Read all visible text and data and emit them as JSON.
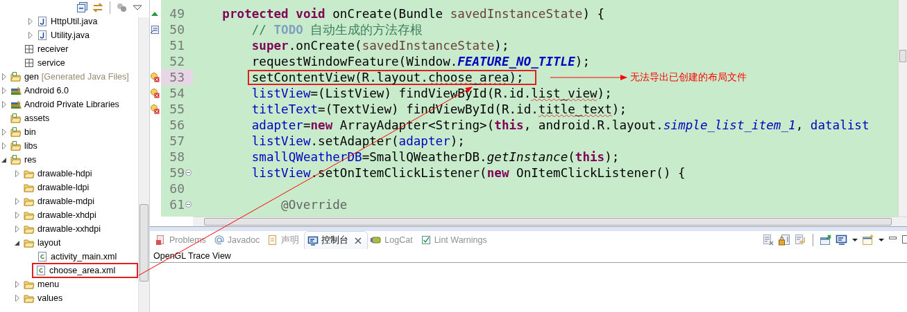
{
  "explorer": {
    "toolbar": [
      {
        "kind": "collapse"
      },
      {
        "kind": "link"
      },
      {
        "kind": "separator"
      },
      {
        "kind": "filter"
      },
      {
        "kind": "menu"
      }
    ],
    "items": [
      {
        "children": [
          {
            "children": [
              {
                "label": "HttpUtil.java",
                "kind": "java",
                "expanded": false
              },
              {
                "label": "Utility.java",
                "kind": "java",
                "expanded": false
              }
            ]
          },
          {
            "label": "receiver",
            "kind": "package"
          },
          {
            "label": "service",
            "kind": "package"
          }
        ]
      },
      {
        "label": "gen",
        "decoration": "[Generated Java Files]",
        "kind": "source-folder",
        "expanded": false
      },
      {
        "label": "Android 6.0",
        "kind": "library",
        "expanded": false
      },
      {
        "label": "Android Private Libraries",
        "kind": "library",
        "expanded": false
      },
      {
        "label": "assets",
        "kind": "source-folder"
      },
      {
        "label": "bin",
        "kind": "source-folder",
        "expanded": false
      },
      {
        "label": "libs",
        "kind": "source-folder",
        "expanded": false
      },
      {
        "label": "res",
        "kind": "source-folder",
        "expanded": true,
        "children": [
          {
            "label": "drawable-hdpi",
            "kind": "folder",
            "expanded": false
          },
          {
            "label": "drawable-ldpi",
            "kind": "folder"
          },
          {
            "label": "drawable-mdpi",
            "kind": "folder",
            "expanded": false
          },
          {
            "label": "drawable-xhdpi",
            "kind": "folder",
            "expanded": false
          },
          {
            "label": "drawable-xxhdpi",
            "kind": "folder",
            "expanded": false
          },
          {
            "label": "layout",
            "kind": "folder",
            "expanded": true,
            "children": [
              {
                "label": "activity_main.xml",
                "kind": "xml"
              },
              {
                "label": "choose_area.xml",
                "kind": "xml",
                "highlighted": true
              }
            ]
          },
          {
            "label": "menu",
            "kind": "folder",
            "expanded": false
          },
          {
            "label": "values",
            "kind": "folder",
            "expanded": false
          }
        ]
      }
    ]
  },
  "editor": {
    "lines": [
      {
        "number": "49",
        "marker": {
          "kind": "override"
        },
        "tokens": [
          {
            "kind": "keyword",
            "text": "protected"
          },
          {
            "kind": "keyword",
            "text": " void"
          },
          {
            "kind": "plain",
            "text": " onCreate(Bundle "
          },
          {
            "kind": "param",
            "text": "savedInstanceState"
          },
          {
            "kind": "plain",
            "text": ") {"
          }
        ],
        "children": [
          {
            "number": "50",
            "marker": {
              "kind": "task"
            },
            "tokens": [
              {
                "kind": "comment",
                "text": "// "
              },
              {
                "kind": "todo",
                "text": "TODO"
              },
              {
                "kind": "comment",
                "text": " 自动生成的方法存根"
              }
            ]
          },
          {
            "number": "51",
            "tokens": [
              {
                "kind": "keyword",
                "text": "super"
              },
              {
                "kind": "plain",
                "text": ".onCreate("
              },
              {
                "kind": "param",
                "text": "savedInstanceState"
              },
              {
                "kind": "plain",
                "text": ");"
              }
            ]
          },
          {
            "number": "52",
            "tokens": [
              {
                "kind": "plain",
                "text": "requestWindowFeature(Window."
              },
              {
                "kind": "constant",
                "text": "FEATURE_NO_TITLE"
              },
              {
                "kind": "plain",
                "text": ");"
              }
            ]
          },
          {
            "number": "53",
            "marker": {
              "kind": "error"
            },
            "current": true,
            "highlighted": true,
            "tokens": [
              {
                "kind": "plain",
                "text": "setContentView(R.layout."
              },
              {
                "kind": "error",
                "text": "choose_area"
              },
              {
                "kind": "plain",
                "text": ");"
              }
            ]
          },
          {
            "number": "54",
            "marker": {
              "kind": "error"
            },
            "tokens": [
              {
                "kind": "field",
                "text": "listView"
              },
              {
                "kind": "plain",
                "text": "=(ListView) findViewById(R.id."
              },
              {
                "kind": "error",
                "text": "list_view"
              },
              {
                "kind": "plain",
                "text": ");"
              }
            ]
          },
          {
            "number": "55",
            "marker": {
              "kind": "error"
            },
            "tokens": [
              {
                "kind": "field",
                "text": "titleText"
              },
              {
                "kind": "plain",
                "text": "=(TextView) findViewById(R.id."
              },
              {
                "kind": "error",
                "text": "title_text"
              },
              {
                "kind": "plain",
                "text": ");"
              }
            ]
          },
          {
            "number": "56",
            "tokens": [
              {
                "kind": "field",
                "text": "adapter"
              },
              {
                "kind": "plain",
                "text": "="
              },
              {
                "kind": "keyword",
                "text": "new"
              },
              {
                "kind": "plain",
                "text": " ArrayAdapter<String>("
              },
              {
                "kind": "keyword",
                "text": "this"
              },
              {
                "kind": "plain",
                "text": ", android.R.layout."
              },
              {
                "kind": "static",
                "text": "simple_list_item_1"
              },
              {
                "kind": "plain",
                "text": ", "
              },
              {
                "kind": "field",
                "text": "datalist"
              }
            ]
          },
          {
            "number": "57",
            "tokens": [
              {
                "kind": "field",
                "text": "listView"
              },
              {
                "kind": "plain",
                "text": ".setAdapter("
              },
              {
                "kind": "field",
                "text": "adapter"
              },
              {
                "kind": "plain",
                "text": ");"
              }
            ]
          },
          {
            "number": "58",
            "tokens": [
              {
                "kind": "field",
                "text": "smallQWeatherDB"
              },
              {
                "kind": "plain",
                "text": "=SmallQWeatherDB."
              },
              {
                "kind": "method",
                "text": "getInstance"
              },
              {
                "kind": "plain",
                "text": "("
              },
              {
                "kind": "keyword",
                "text": "this"
              },
              {
                "kind": "plain",
                "text": ");"
              }
            ]
          },
          {
            "number": "59",
            "collapsed": false,
            "tokens": [
              {
                "kind": "field",
                "text": "listView"
              },
              {
                "kind": "plain",
                "text": ".setOnItemClickListener("
              },
              {
                "kind": "keyword",
                "text": "new"
              },
              {
                "kind": "plain",
                "text": " OnItemClickListener() {"
              }
            ],
            "children": [
              {
                "number": "60"
              },
              {
                "number": "61",
                "collapsed": false,
                "tokens": [
                  {
                    "kind": "annotation",
                    "text": "@Override"
                  }
                ]
              }
            ]
          }
        ]
      }
    ]
  },
  "panel": {
    "tabs": [
      {
        "label": "Problems",
        "kind": "problems",
        "selected": false
      },
      {
        "label": "Javadoc",
        "kind": "javadoc",
        "selected": false
      },
      {
        "label": "声明",
        "kind": "declaration",
        "selected": false
      },
      {
        "label": "控制台",
        "kind": "console",
        "selected": true
      },
      {
        "label": "LogCat",
        "kind": "logcat",
        "selected": false
      },
      {
        "label": "Lint Warnings",
        "kind": "lint",
        "selected": false
      }
    ],
    "toolbar": [
      {
        "kind": "clear"
      },
      {
        "kind": "lock"
      },
      {
        "kind": "wrap"
      },
      {
        "kind": "separator"
      },
      {
        "kind": "pin"
      },
      {
        "kind": "display"
      },
      {
        "kind": "caret"
      },
      {
        "kind": "open"
      },
      {
        "kind": "caret"
      },
      {
        "kind": "minimize"
      },
      {
        "kind": "maximize"
      }
    ],
    "overflow_tab": {
      "label": "OpenGL Trace View"
    }
  },
  "annotation": {
    "note": "无法导出已创建的布局文件"
  }
}
